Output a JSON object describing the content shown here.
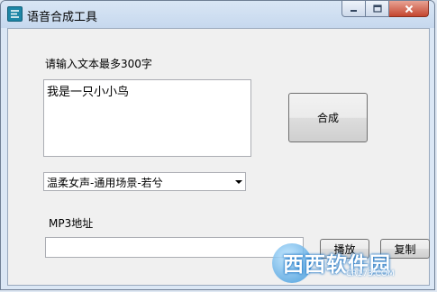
{
  "window": {
    "title": "语音合成工具",
    "icon": "app-logo-icon",
    "controls": {
      "minimize": "minimize-icon",
      "maximize": "maximize-icon",
      "close": "close-icon"
    }
  },
  "form": {
    "text_label": "请输入文本最多300字",
    "text_value": "我是一只小小鸟",
    "synthesize_label": "合成",
    "voice_select": {
      "selected": "温柔女声-通用场景-若兮"
    },
    "mp3_label": "MP3地址",
    "mp3_value": "",
    "play_label": "播放",
    "copy_label": "复制"
  },
  "watermark": {
    "brand": "西西软件园",
    "url": "CR173.COM"
  },
  "colors": {
    "title_bar": "#c6d8ee",
    "client_bg": "#f0f0f0",
    "close_button": "#c4462f"
  }
}
